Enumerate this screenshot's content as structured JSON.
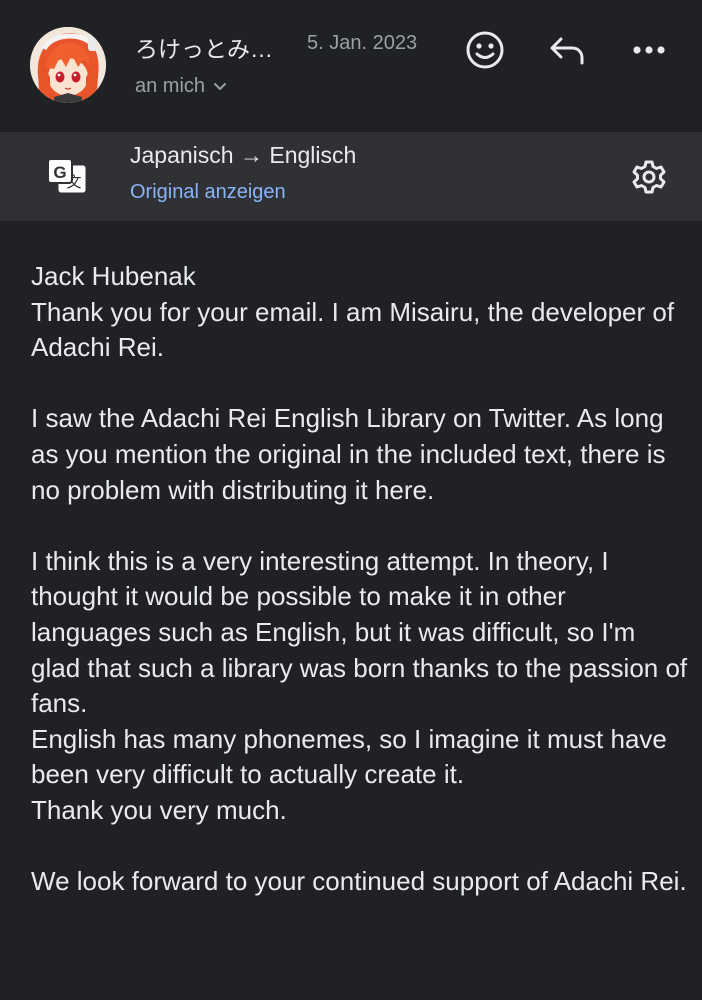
{
  "header": {
    "sender_name": "ろけっとみ…",
    "date": "5. Jan. 2023",
    "recipient": "an mich",
    "icons": {
      "emoji": "smiley-face-icon",
      "reply": "reply-arrow-icon",
      "more": "more-dots-icon",
      "recipient_toggle": "chevron-down-icon"
    }
  },
  "translation": {
    "lang_pair": "Japanisch → Englisch",
    "show_original": "Original anzeigen",
    "icons": {
      "translate": "google-translate-icon",
      "settings": "gear-icon"
    }
  },
  "message": {
    "paragraphs": [
      "Jack Hubenak\nThank you for your email. I am Misairu, the developer of Adachi Rei.",
      "I saw the Adachi Rei English Library on Twitter. As long as you mention the original in the included text, there is no problem with distributing it here.",
      "I think this is a very interesting attempt. In theory, I thought it would be possible to make it in other languages such as English, but it was difficult, so I'm glad that such a library was born thanks to the passion of fans.\nEnglish has many phonemes, so I imagine it must have been very difficult to actually create it.\nThank you very much.",
      "We look forward to your continued support of Adachi Rei."
    ]
  },
  "colors": {
    "background": "#202124",
    "translate_bar": "#303134",
    "text_primary": "#e8eaed",
    "text_secondary": "#9aa0a6",
    "link": "#8ab4f8"
  }
}
